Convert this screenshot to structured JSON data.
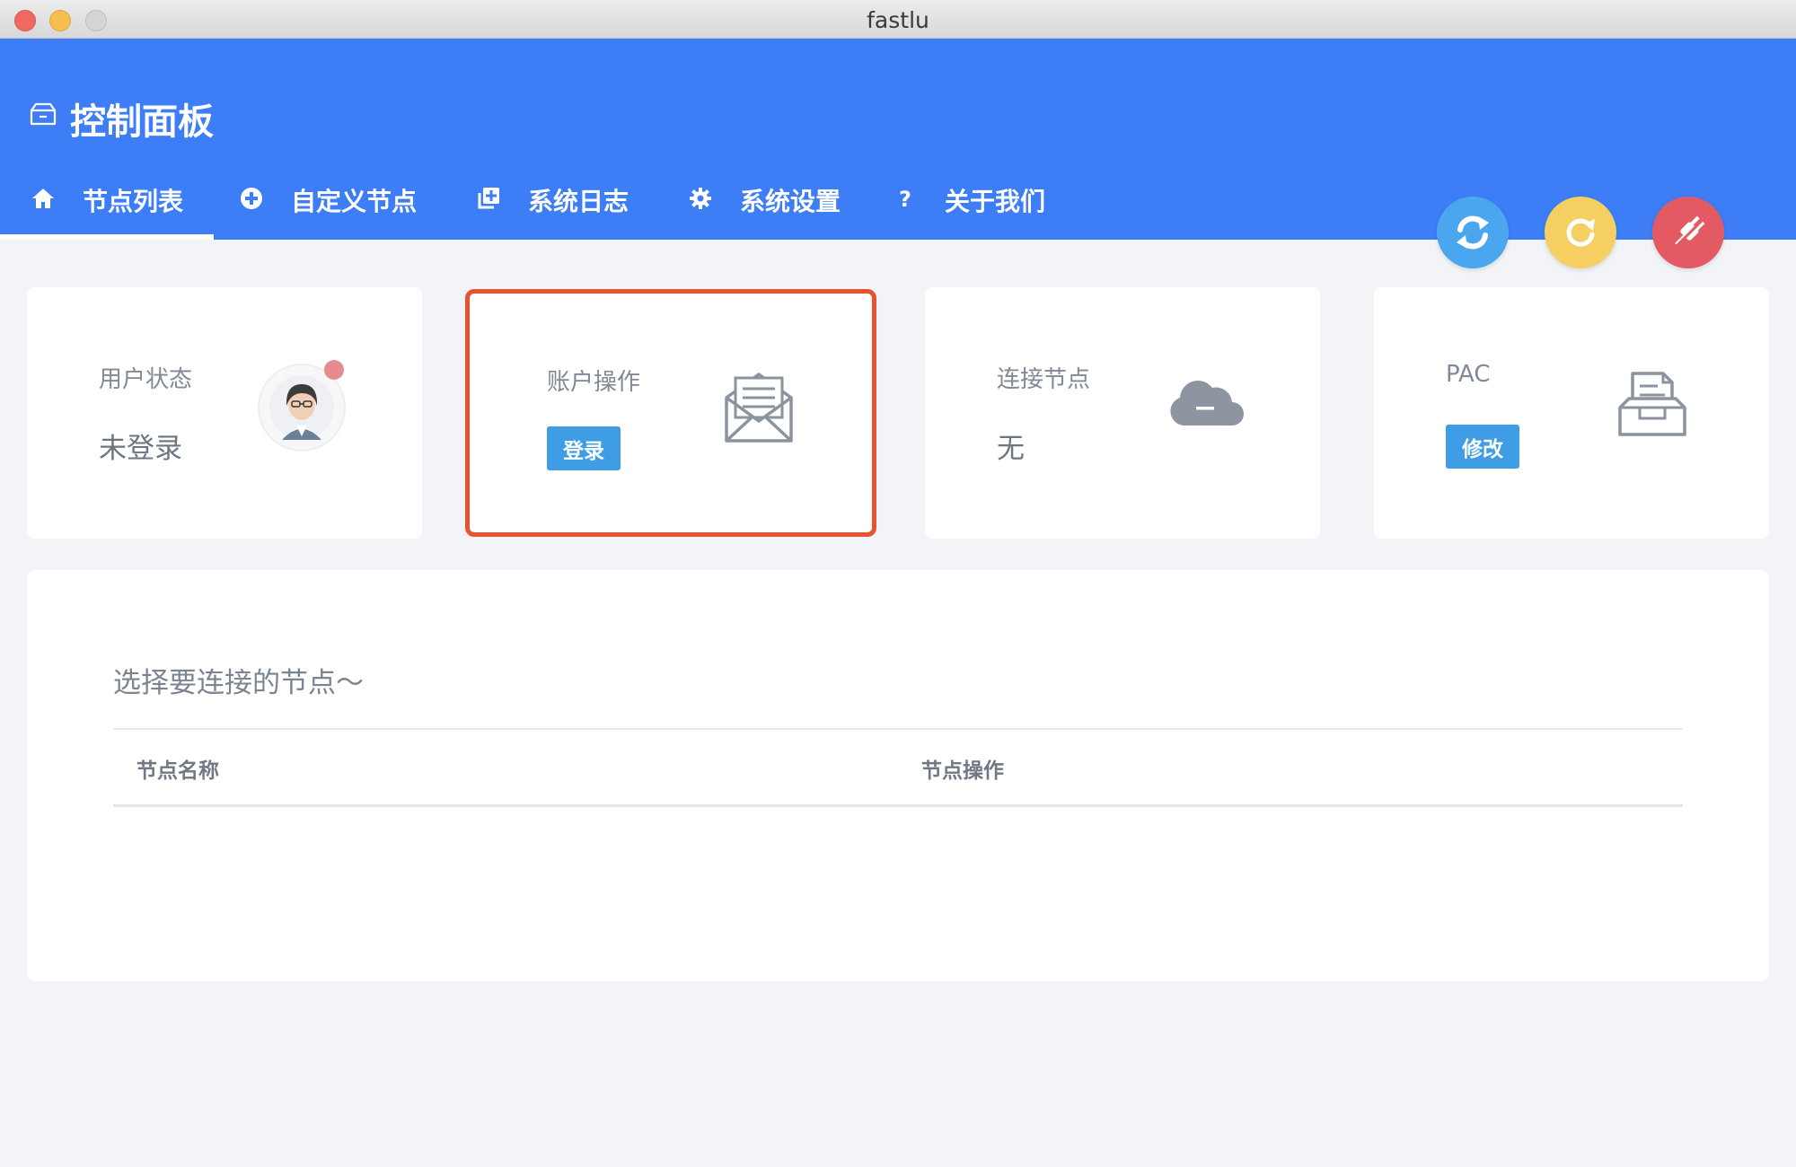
{
  "window": {
    "title": "fastlu"
  },
  "header": {
    "title": "控制面板",
    "title_icon": "inbox-icon",
    "accent_color": "#3d7ef7"
  },
  "nav": {
    "items": [
      {
        "label": "节点列表",
        "icon": "home-icon",
        "active": true
      },
      {
        "label": "自定义节点",
        "icon": "plus-circle-icon",
        "active": false
      },
      {
        "label": "系统日志",
        "icon": "copy-plus-icon",
        "active": false
      },
      {
        "label": "系统设置",
        "icon": "gear-icon",
        "active": false
      },
      {
        "label": "关于我们",
        "icon": "question-icon",
        "active": false
      }
    ]
  },
  "actions": [
    {
      "name": "sync",
      "icon": "sync-icon",
      "color": "#4aa6ef"
    },
    {
      "name": "refresh",
      "icon": "refresh-icon",
      "color": "#f6cf62"
    },
    {
      "name": "disconnect",
      "icon": "unplug-icon",
      "color": "#e35a63"
    }
  ],
  "cards": {
    "user_status": {
      "label": "用户状态",
      "value": "未登录",
      "icon": "user-avatar-icon"
    },
    "account": {
      "label": "账户操作",
      "button": "登录",
      "icon": "envelope-open-icon"
    },
    "connect_node": {
      "label": "连接节点",
      "value": "无",
      "icon": "cloud-icon"
    },
    "pac": {
      "label": "PAC",
      "button": "修改",
      "icon": "inbox-tray-icon"
    }
  },
  "node_panel": {
    "title": "选择要连接的节点～",
    "columns": [
      "节点名称",
      "节点操作"
    ]
  },
  "colors": {
    "button": "#3e9de4",
    "highlight_border": "#e8532f"
  }
}
